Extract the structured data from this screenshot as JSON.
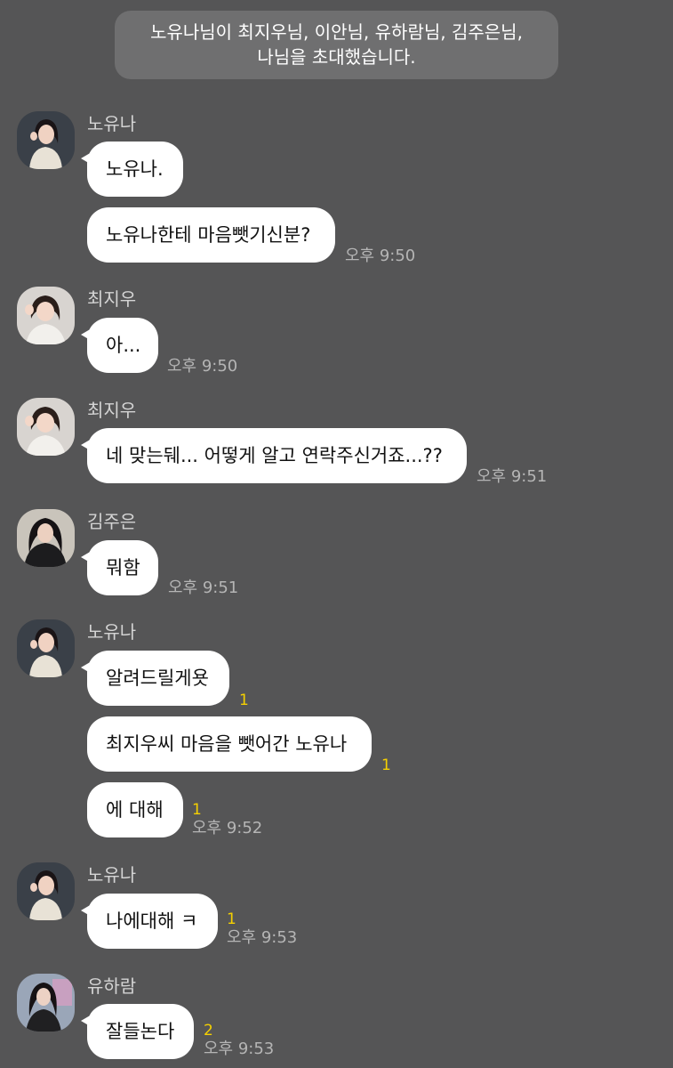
{
  "notice": {
    "line1": "노유나님이 최지우님, 이안님, 유하람님, 김주은님,",
    "line2": "나님을 초대했습니다."
  },
  "messages": [
    {
      "sender": "노유나",
      "avatar_icon": "profile-photo-icon",
      "bubbles": [
        {
          "text": "노유나."
        },
        {
          "text": "노유나한테 마음뺏기신분?",
          "time": "오후 9:50"
        }
      ]
    },
    {
      "sender": "최지우",
      "avatar_icon": "profile-photo-icon",
      "bubbles": [
        {
          "text": "아...",
          "time": "오후 9:50"
        }
      ]
    },
    {
      "sender": "최지우",
      "avatar_icon": "profile-photo-icon",
      "bubbles": [
        {
          "text": "네 맞는뒈... 어떻게 알고 연락주신거죠...??",
          "time": "오후 9:51"
        }
      ]
    },
    {
      "sender": "김주은",
      "avatar_icon": "profile-photo-icon",
      "bubbles": [
        {
          "text": "뭐함",
          "time": "오후 9:51"
        }
      ]
    },
    {
      "sender": "노유나",
      "avatar_icon": "profile-photo-icon",
      "bubbles": [
        {
          "text": "알려드릴게욧",
          "unread": "1"
        },
        {
          "text": "최지우씨 마음을 뺏어간 노유나",
          "unread": "1"
        },
        {
          "text": "에 대해",
          "unread": "1",
          "time": "오후 9:52"
        }
      ]
    },
    {
      "sender": "노유나",
      "avatar_icon": "profile-photo-icon",
      "bubbles": [
        {
          "text": "나에대해 ㅋ",
          "unread": "1",
          "time": "오후 9:53"
        }
      ]
    },
    {
      "sender": "유하람",
      "avatar_icon": "profile-photo-icon",
      "bubbles": [
        {
          "text": "잘들논다",
          "unread": "2",
          "time": "오후 9:53"
        }
      ]
    }
  ],
  "colors": {
    "background": "#555556",
    "bubble": "#ffffff",
    "unread_count": "#f5d000",
    "timestamp": "#b5b5b5"
  }
}
